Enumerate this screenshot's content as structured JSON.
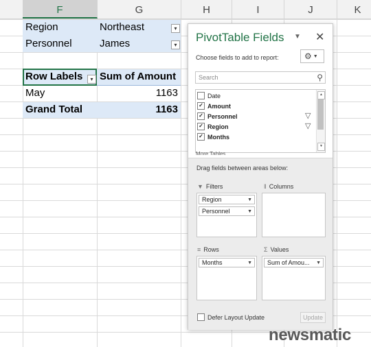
{
  "sheet": {
    "columns": [
      "F",
      "G",
      "H",
      "I",
      "J",
      "K"
    ],
    "selected_column": "F",
    "filters": [
      {
        "field": "Region",
        "value": "Northeast"
      },
      {
        "field": "Personnel",
        "value": "James"
      }
    ],
    "pivot_header": {
      "row_labels": "Row Labels",
      "sum_label": "Sum of Amount"
    },
    "rows": [
      {
        "label": "May",
        "value": "1163"
      }
    ],
    "grand_total": {
      "label": "Grand Total",
      "value": "1163"
    }
  },
  "panel": {
    "title": "PivotTable Fields",
    "choose_text": "Choose fields to add to report:",
    "search_placeholder": "Search",
    "fields": [
      {
        "name": "Date",
        "checked": false,
        "filtered": false
      },
      {
        "name": "Amount",
        "checked": true,
        "filtered": false
      },
      {
        "name": "Personnel",
        "checked": true,
        "filtered": true
      },
      {
        "name": "Region",
        "checked": true,
        "filtered": true
      },
      {
        "name": "Months",
        "checked": true,
        "filtered": false
      }
    ],
    "more_tables": "More Tables...",
    "drag_text": "Drag fields between areas below:",
    "areas": {
      "filters": {
        "label": "Filters",
        "items": [
          "Region",
          "Personnel"
        ]
      },
      "columns": {
        "label": "Columns",
        "items": []
      },
      "rows": {
        "label": "Rows",
        "items": [
          "Months"
        ]
      },
      "values": {
        "label": "Values",
        "items": [
          "Sum of Amou..."
        ]
      }
    },
    "defer_label": "Defer Layout Update",
    "update_label": "Update"
  },
  "watermark": "newsmatic",
  "colors": {
    "excel_green": "#217346",
    "pivot_band": "#dde9f7",
    "header_bg": "#f2f2f2"
  }
}
